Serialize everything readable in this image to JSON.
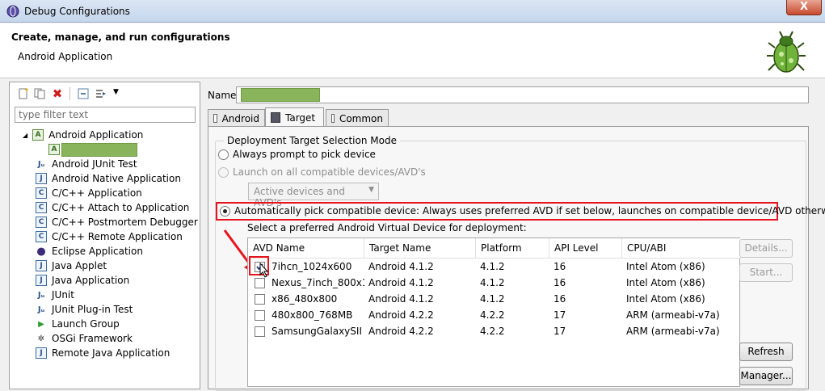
{
  "window": {
    "title": "Debug Configurations",
    "close_label": "X"
  },
  "header": {
    "title": "Create, manage, and run configurations",
    "subtitle": "Android Application"
  },
  "left": {
    "filter_placeholder": "type filter text",
    "tree": {
      "root": "Android Application",
      "items": [
        "Android JUnit Test",
        "Android Native Application",
        "C/C++ Application",
        "C/C++ Attach to Application",
        "C/C++ Postmortem Debugger",
        "C/C++ Remote Application",
        "Eclipse Application",
        "Java Applet",
        "Java Application",
        "JUnit",
        "JUnit Plug-in Test",
        "Launch Group",
        "OSGi Framework",
        "Remote Java Application"
      ]
    }
  },
  "form": {
    "name_label": "Name:",
    "tabs": [
      "Android",
      "Target",
      "Common"
    ],
    "group_title": "Deployment Target Selection Mode",
    "opt_always": "Always prompt to pick device",
    "opt_launch_all": "Launch on all compatible devices/AVD's",
    "dropdown_value": "Active devices and AVD's",
    "opt_auto": "Automatically pick compatible device: Always uses preferred AVD if set below, launches on compatible device/AVD otherwise.",
    "avd_prompt": "Select a preferred Android Virtual Device for deployment:"
  },
  "avd_table": {
    "columns": [
      "AVD Name",
      "Target Name",
      "Platform",
      "API Level",
      "CPU/ABI"
    ],
    "rows": [
      {
        "name": "7ihcn_1024x600",
        "target": "Android 4.1.2",
        "platform": "4.1.2",
        "api": "16",
        "cpu": "Intel Atom (x86)",
        "checked": true
      },
      {
        "name": "Nexus_7inch_800x1...",
        "target": "Android 4.1.2",
        "platform": "4.1.2",
        "api": "16",
        "cpu": "Intel Atom (x86)",
        "checked": false
      },
      {
        "name": "x86_480x800",
        "target": "Android 4.1.2",
        "platform": "4.1.2",
        "api": "16",
        "cpu": "Intel Atom (x86)",
        "checked": false
      },
      {
        "name": "480x800_768MB",
        "target": "Android 4.2.2",
        "platform": "4.2.2",
        "api": "17",
        "cpu": "ARM (armeabi-v7a)",
        "checked": false
      },
      {
        "name": "SamsungGalaxySII",
        "target": "Android 4.2.2",
        "platform": "4.2.2",
        "api": "17",
        "cpu": "ARM (armeabi-v7a)",
        "checked": false
      }
    ]
  },
  "buttons": {
    "details": "Details...",
    "start": "Start...",
    "refresh": "Refresh",
    "manager": "Manager..."
  },
  "colors": {
    "highlight_red": "#e8141d",
    "redacted_green": "#8ab45b"
  }
}
